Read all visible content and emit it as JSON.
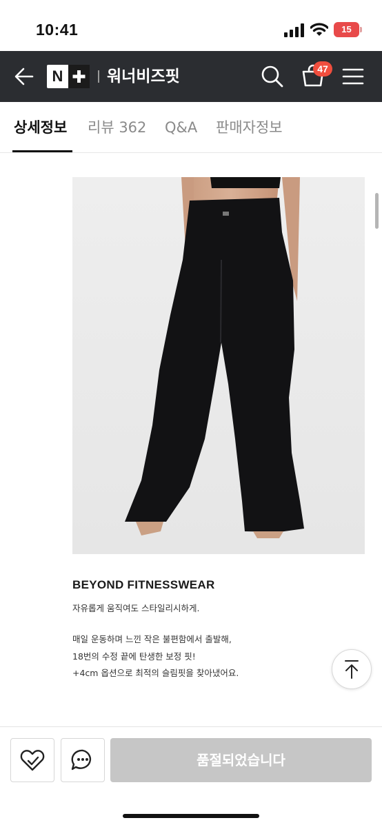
{
  "status_bar": {
    "time": "10:41",
    "battery_level": "15",
    "icons": [
      "signal-icon",
      "wifi-icon",
      "battery-icon"
    ]
  },
  "header": {
    "logo_letter": "N",
    "store_name": "워너비즈핏",
    "cart_count": "47",
    "icons": [
      "back-arrow-icon",
      "search-icon",
      "cart-icon",
      "menu-icon"
    ],
    "colors": {
      "background": "#2b2d31",
      "badge": "#f04e3e"
    }
  },
  "tabs": [
    {
      "label": "상세정보",
      "active": true
    },
    {
      "label": "리뷰 362",
      "active": false
    },
    {
      "label": "Q&A",
      "active": false
    },
    {
      "label": "판매자정보",
      "active": false
    }
  ],
  "product": {
    "image_subject": "black flared leggings",
    "title": "BEYOND FITNESSWEAR",
    "lines": [
      "자유롭게 움직여도 스타일리시하게.",
      "매일 운동하며 느낀 작은 불편함에서 출발해,",
      "18번의 수정 끝에 탄생한 보정 핏!",
      "+4cm 옵션으로 최적의 슬림핏을 찾아냈어요."
    ]
  },
  "bottom_bar": {
    "soldout_label": "품절되었습니다",
    "icons": [
      "heart-icon",
      "chat-bubble-icon",
      "arrow-up-icon"
    ],
    "colors": {
      "disabled_button": "#c6c6c6"
    }
  }
}
